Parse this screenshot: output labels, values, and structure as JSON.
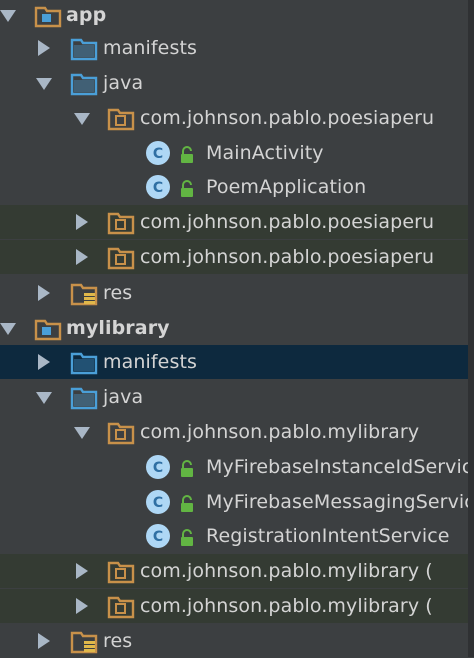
{
  "tree": {
    "app": {
      "label": "app"
    },
    "app_manifests": {
      "label": "manifests"
    },
    "app_java": {
      "label": "java"
    },
    "app_pkg_main": {
      "label": "com.johnson.pablo.poesiaperu"
    },
    "app_class_main_activity": {
      "label": "MainActivity"
    },
    "app_class_poem_application": {
      "label": "PoemApplication"
    },
    "app_pkg_android_test": {
      "label": "com.johnson.pablo.poesiaperu"
    },
    "app_pkg_test": {
      "label": "com.johnson.pablo.poesiaperu"
    },
    "app_res": {
      "label": "res"
    },
    "mylibrary": {
      "label": "mylibrary"
    },
    "lib_manifests": {
      "label": "manifests"
    },
    "lib_java": {
      "label": "java"
    },
    "lib_pkg_main": {
      "label": "com.johnson.pablo.mylibrary"
    },
    "lib_class_instance_id": {
      "label": "MyFirebaseInstanceIdService"
    },
    "lib_class_messaging": {
      "label": "MyFirebaseMessagingService"
    },
    "lib_class_registration": {
      "label": "RegistrationIntentService"
    },
    "lib_pkg_android_test": {
      "label": "com.johnson.pablo.mylibrary ("
    },
    "lib_pkg_test": {
      "label": "com.johnson.pablo.mylibrary ("
    },
    "lib_res": {
      "label": "res"
    }
  },
  "colors": {
    "background": "#3c3f41",
    "selected_row": "#0d293e",
    "test_row": "#343b33",
    "folder_blue": "#4a9fd8",
    "package_orange": "#c8914a",
    "class_circle": "#aed7f5",
    "lock_green": "#62b543"
  }
}
